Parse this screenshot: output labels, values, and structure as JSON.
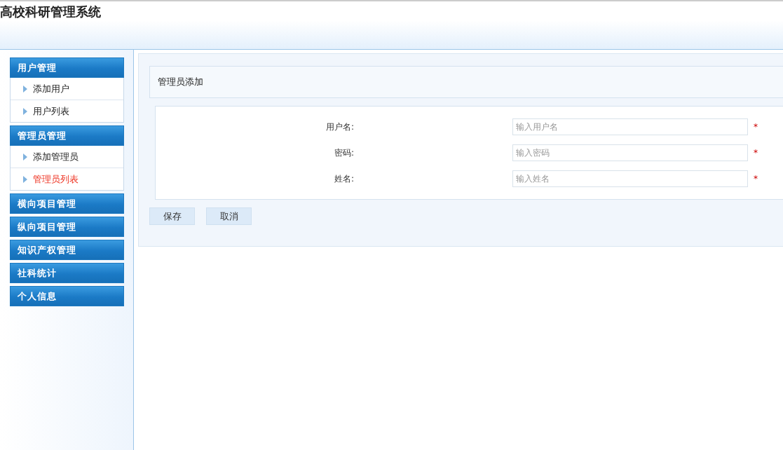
{
  "header": {
    "title": "高校科研管理系统"
  },
  "sidebar": {
    "groups": [
      {
        "title": "用户管理",
        "items": [
          {
            "label": "添加用户",
            "selected": false
          },
          {
            "label": "用户列表",
            "selected": false
          }
        ]
      },
      {
        "title": "管理员管理",
        "items": [
          {
            "label": "添加管理员",
            "selected": false
          },
          {
            "label": "管理员列表",
            "selected": true
          }
        ]
      },
      {
        "title": "横向项目管理"
      },
      {
        "title": "纵向项目管理"
      },
      {
        "title": "知识产权管理"
      },
      {
        "title": "社科统计"
      },
      {
        "title": "个人信息"
      }
    ]
  },
  "panel": {
    "title": "管理员添加",
    "fields": [
      {
        "label": "用户名:",
        "placeholder": "输入用户名",
        "required_mark": "*"
      },
      {
        "label": "密码:",
        "placeholder": "输入密码",
        "required_mark": "*"
      },
      {
        "label": "姓名:",
        "placeholder": "输入姓名",
        "required_mark": "*"
      }
    ],
    "buttons": [
      "保存",
      "取消"
    ]
  }
}
